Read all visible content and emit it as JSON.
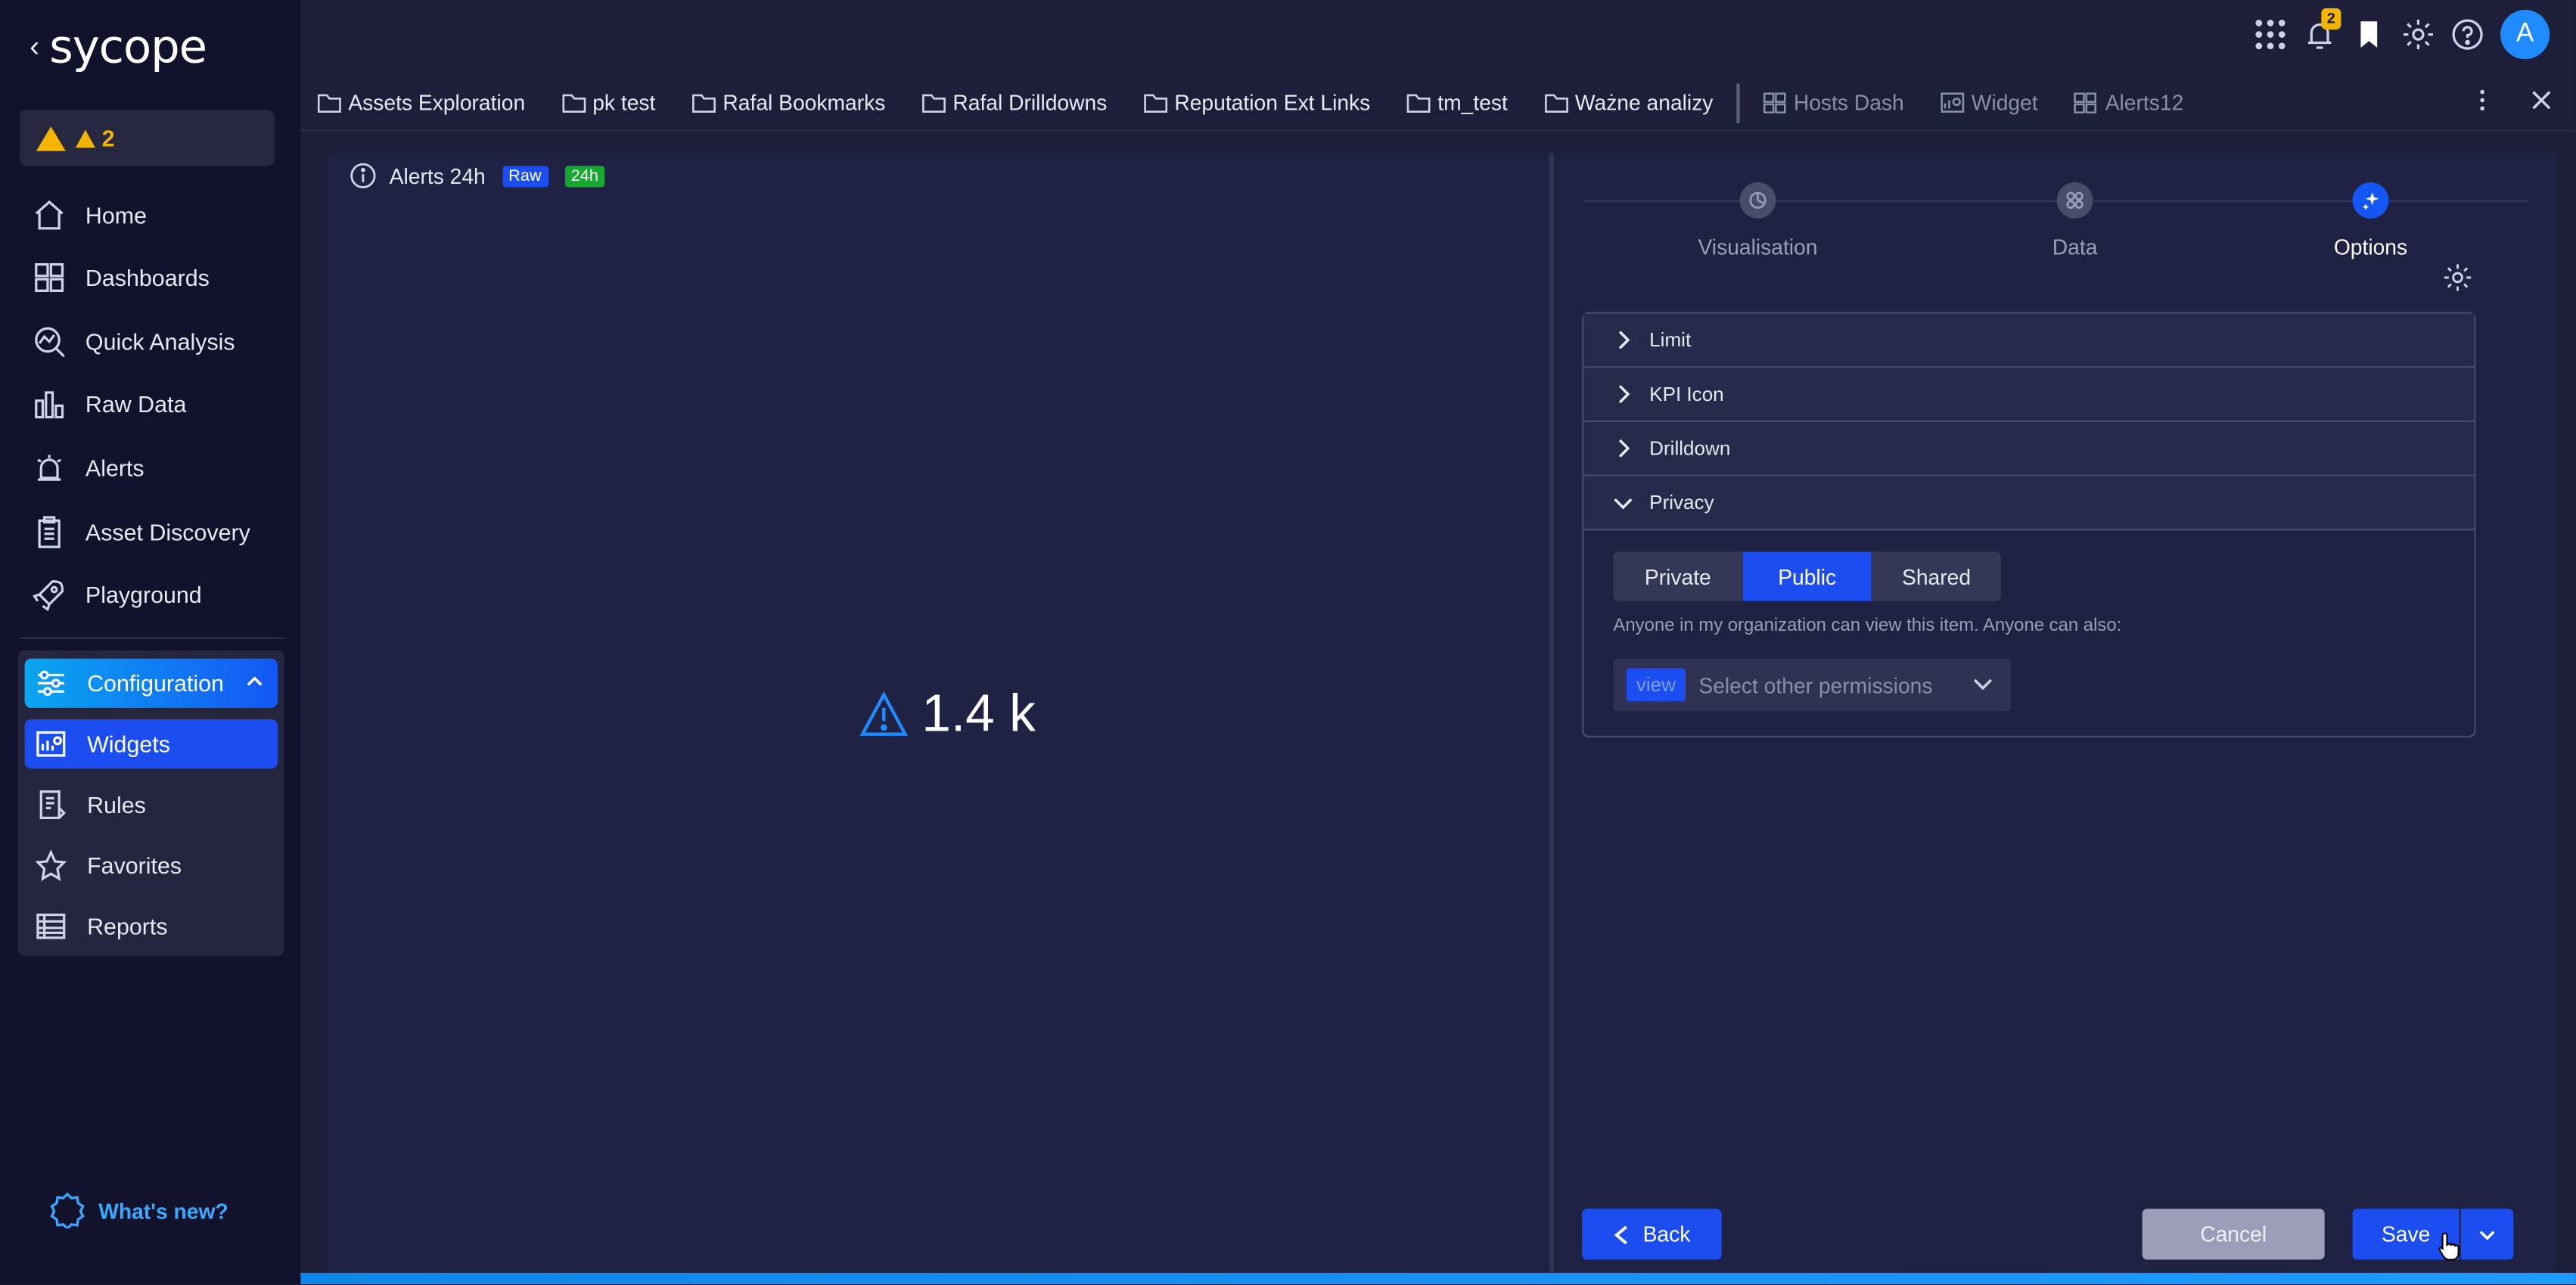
{
  "sidebar": {
    "logo_text": "sycope",
    "alert_count": "2",
    "nav": [
      {
        "label": "Home",
        "icon": "home-icon"
      },
      {
        "label": "Dashboards",
        "icon": "dashboards-icon"
      },
      {
        "label": "Quick Analysis",
        "icon": "quick-analysis-icon"
      },
      {
        "label": "Raw Data",
        "icon": "raw-data-icon"
      },
      {
        "label": "Alerts",
        "icon": "alarm-icon"
      },
      {
        "label": "Asset Discovery",
        "icon": "clipboard-icon"
      },
      {
        "label": "Playground",
        "icon": "rocket-icon"
      }
    ],
    "config": {
      "label": "Configuration",
      "items": [
        {
          "label": "Widgets",
          "icon": "widgets-icon"
        },
        {
          "label": "Rules",
          "icon": "rules-icon"
        },
        {
          "label": "Favorites",
          "icon": "star-icon"
        },
        {
          "label": "Reports",
          "icon": "reports-icon"
        }
      ]
    },
    "whats_new": "What's new?"
  },
  "topbar": {
    "notification_count": "2",
    "avatar_initial": "A"
  },
  "bookmarks": {
    "folders": [
      "Assets Exploration",
      "pk test",
      "Rafal Bookmarks",
      "Rafal Drilldowns",
      "Reputation Ext Links",
      "tm_test",
      "Ważne analizy"
    ],
    "items": [
      "Hosts Dash",
      "Widget",
      "Alerts12"
    ]
  },
  "widget": {
    "title": "Alerts 24h",
    "tag_raw": "Raw",
    "tag_time": "24h",
    "kpi_value": "1.4 k"
  },
  "steps": [
    {
      "label": "Visualisation",
      "active": false
    },
    {
      "label": "Data",
      "active": false
    },
    {
      "label": "Options",
      "active": true
    }
  ],
  "accordion": {
    "sections": [
      "Limit",
      "KPI Icon",
      "Drilldown",
      "Privacy"
    ],
    "privacy": {
      "options": [
        "Private",
        "Public",
        "Shared"
      ],
      "selected": "Public",
      "note": "Anyone in my organization can view this item. Anyone can also:",
      "chip": "view",
      "placeholder": "Select other permissions"
    }
  },
  "footer": {
    "back_label": "Back",
    "cancel_label": "Cancel",
    "save_label": "Save"
  },
  "colors": {
    "accent": "#1b4df0",
    "warning": "#f5b400",
    "success": "#17a832",
    "sidebar_bg": "#11132c",
    "panel_bg": "#202244"
  }
}
